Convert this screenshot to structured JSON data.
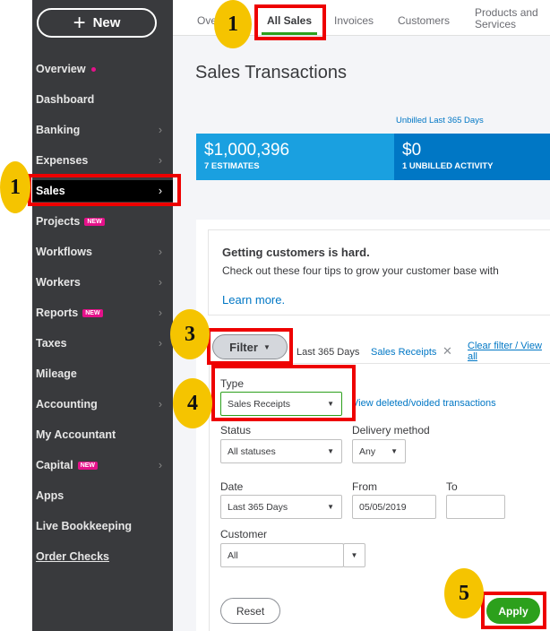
{
  "sidebar": {
    "new_label": "New",
    "items": [
      {
        "label": "Overview"
      },
      {
        "label": "Dashboard"
      },
      {
        "label": "Banking"
      },
      {
        "label": "Expenses"
      },
      {
        "label": "Sales"
      },
      {
        "label": "Projects",
        "badge": "NEW"
      },
      {
        "label": "Workflows"
      },
      {
        "label": "Workers"
      },
      {
        "label": "Reports",
        "badge": "NEW"
      },
      {
        "label": "Taxes"
      },
      {
        "label": "Mileage"
      },
      {
        "label": "Accounting"
      },
      {
        "label": "My Accountant"
      },
      {
        "label": "Capital",
        "badge": "NEW"
      },
      {
        "label": "Apps"
      },
      {
        "label": "Live Bookkeeping"
      },
      {
        "label": "Order Checks"
      }
    ]
  },
  "tabs": [
    "Overview",
    "All Sales",
    "Invoices",
    "Customers",
    "Products and Services"
  ],
  "page_title": "Sales Transactions",
  "summary": {
    "unbilled_caption": "Unbilled Last 365 Days",
    "estimates_amount": "$1,000,396",
    "estimates_label": "7 ESTIMATES",
    "unbilled_amount": "$0",
    "unbilled_label": "1 UNBILLED ACTIVITY"
  },
  "tip": {
    "title": "Getting customers is hard.",
    "body": "Check out these four tips to grow your customer base with",
    "link": "Learn more."
  },
  "filter": {
    "button": "Filter",
    "chip_period": "Last 365 Days",
    "chip_type": "Sales Receipts",
    "clear": "Clear filter / View all",
    "type_label": "Type",
    "type_value": "Sales Receipts",
    "deleted_link": "View deleted/voided transactions",
    "status_label": "Status",
    "status_value": "All statuses",
    "delivery_label": "Delivery method",
    "delivery_value": "Any",
    "date_label": "Date",
    "date_value": "Last 365 Days",
    "from_label": "From",
    "from_value": "05/05/2019",
    "to_label": "To",
    "to_value": "",
    "customer_label": "Customer",
    "customer_value": "All",
    "reset": "Reset",
    "apply": "Apply"
  },
  "steps": [
    "1",
    "1",
    "3",
    "4",
    "5"
  ],
  "colors": {
    "sidebar": "#393a3d",
    "accent": "#2ca01c",
    "blue": "#0077c5",
    "highlight": "#e00000"
  }
}
